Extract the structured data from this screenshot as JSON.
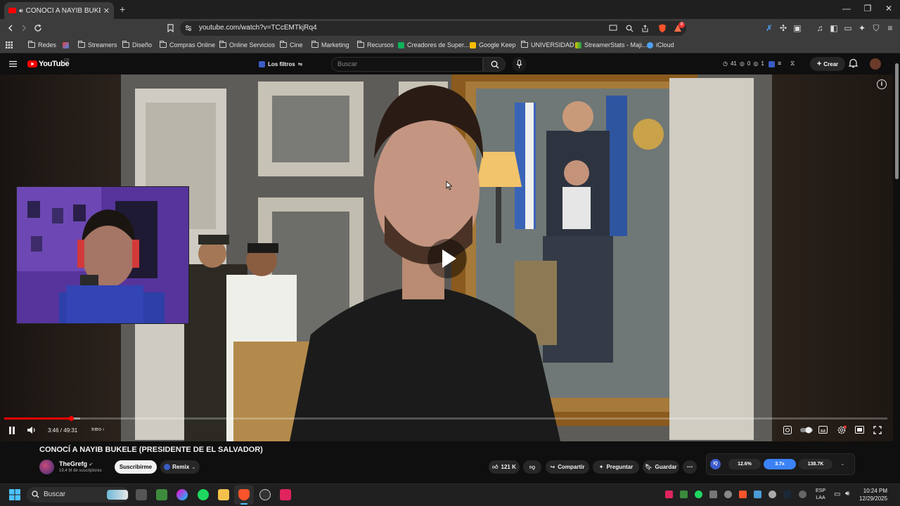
{
  "browser": {
    "tab_title": "CONOCÍ A NAYIB BUKELE (PR",
    "tab_close": "✕",
    "new_tab": "+",
    "url": "youtube.com/watch?v=TCcEMTkjRq4",
    "bookmarks": [
      {
        "label": "Redes",
        "icon": "folder-icon"
      },
      {
        "label": "",
        "icon": "gmail-icon"
      },
      {
        "label": "Streamers",
        "icon": "folder-icon"
      },
      {
        "label": "Diseño",
        "icon": "folder-icon"
      },
      {
        "label": "Compras Online",
        "icon": "folder-icon"
      },
      {
        "label": "Online Servicios",
        "icon": "folder-icon"
      },
      {
        "label": "Cine",
        "icon": "folder-icon"
      },
      {
        "label": "Marketing",
        "icon": "folder-icon"
      },
      {
        "label": "Recursos",
        "icon": "folder-icon"
      },
      {
        "label": "Creadores de Super...",
        "icon": "creadores-icon"
      },
      {
        "label": "Google Keep",
        "icon": "keep-icon"
      },
      {
        "label": "UNIVERSIDAD",
        "icon": "folder-icon"
      },
      {
        "label": "StreamerStats - Maji...",
        "icon": "streamerstats-icon"
      },
      {
        "label": "iCloud",
        "icon": "icloud-icon"
      }
    ],
    "brave_badge": "8"
  },
  "youtube": {
    "logo": "YouTube",
    "country": "CO",
    "filters_label": "Los filtros",
    "search_placeholder": "Buscar",
    "stats": {
      "a": "41",
      "b": "0",
      "c": "1"
    },
    "create_label": "Crear"
  },
  "player": {
    "time": "3:46 / 49:31",
    "chapter": "Intro",
    "progress_fraction": 0.076,
    "buffer_fraction": 0.086
  },
  "video": {
    "title": "CONOCÍ A NAYIB BUKELE (PRESIDENTE DE EL SALVADOR)",
    "channel": "TheGrefg",
    "subscribers": "19,4 M de suscriptores",
    "subscribe": "Suscribirme",
    "remix": "Remix",
    "likes": "121 K",
    "share": "Compartir",
    "ask": "Preguntar",
    "save": "Guardar",
    "more": "⋯"
  },
  "stats_panel": {
    "v1": "12.6%",
    "v2": "3.7x",
    "v3": "138.7K"
  },
  "taskbar": {
    "search": "Buscar",
    "lang1": "ESP",
    "lang2": "LAA",
    "time": "10:24 PM",
    "date": "12/29/2025"
  },
  "colors": {
    "accent_red": "#ff0000",
    "chrome_dark": "#3c3c3c",
    "yt_bg": "#0f0f0f",
    "stats_blue": "#3b82f6"
  }
}
